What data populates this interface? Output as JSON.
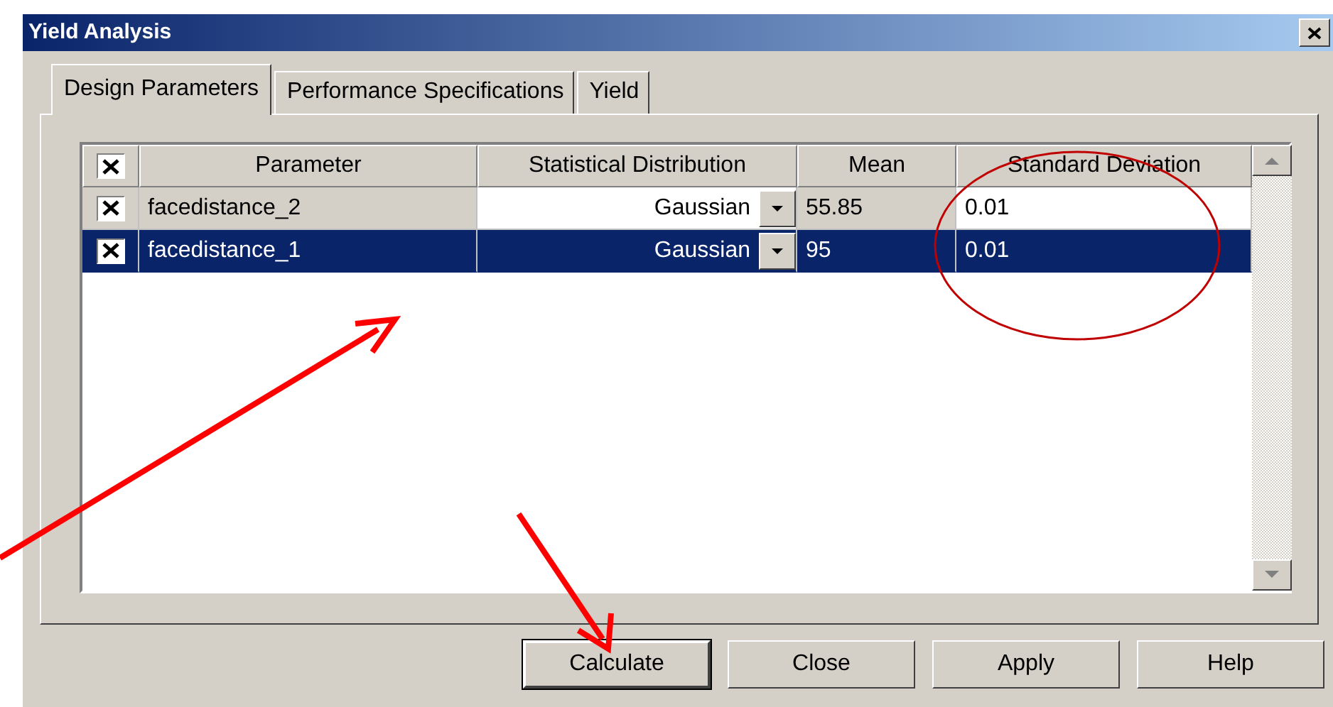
{
  "window": {
    "title": "Yield Analysis"
  },
  "tabs": [
    {
      "label": "Design Parameters",
      "selected": true
    },
    {
      "label": "Performance Specifications",
      "selected": false
    },
    {
      "label": "Yield",
      "selected": false
    }
  ],
  "table": {
    "header_checked": true,
    "columns": [
      {
        "label": "Parameter",
        "editable": false
      },
      {
        "label": "Statistical Distribution",
        "editable": true
      },
      {
        "label": "Mean",
        "editable": false
      },
      {
        "label": "Standard Deviation",
        "editable": true
      }
    ],
    "rows": [
      {
        "checked": true,
        "selected": false,
        "cells": [
          "facedistance_2",
          "Gaussian",
          "55.85",
          "0.01"
        ]
      },
      {
        "checked": true,
        "selected": true,
        "cells": [
          "facedistance_1",
          "Gaussian",
          "95",
          "0.01"
        ]
      }
    ]
  },
  "buttons": [
    {
      "label": "Calculate",
      "default": true
    },
    {
      "label": "Close",
      "default": false
    },
    {
      "label": "Apply",
      "default": false
    },
    {
      "label": "Help",
      "default": false
    }
  ]
}
